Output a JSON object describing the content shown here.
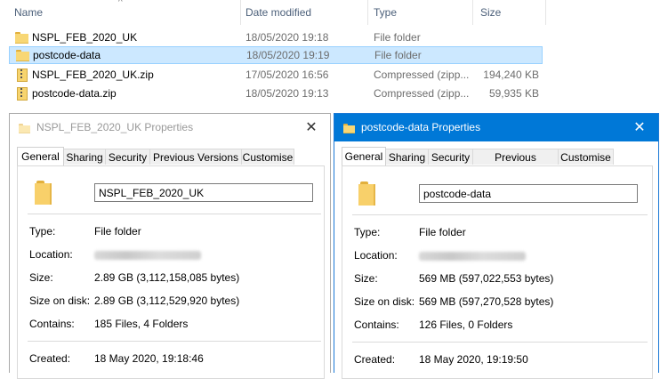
{
  "explorer": {
    "columns": {
      "name": "Name",
      "date": "Date modified",
      "type": "Type",
      "size": "Size"
    },
    "rows": [
      {
        "name": "NSPL_FEB_2020_UK",
        "date": "18/05/2020 19:18",
        "type": "File folder",
        "size": "",
        "icon": "folder-icon",
        "selected": false
      },
      {
        "name": "postcode-data",
        "date": "18/05/2020 19:19",
        "type": "File folder",
        "size": "",
        "icon": "folder-icon",
        "selected": true
      },
      {
        "name": "NSPL_FEB_2020_UK.zip",
        "date": "17/05/2020 16:56",
        "type": "Compressed (zipp...",
        "size": "194,240 KB",
        "icon": "zip-icon",
        "selected": false
      },
      {
        "name": "postcode-data.zip",
        "date": "18/05/2020 19:13",
        "type": "Compressed (zipp...",
        "size": "59,935 KB",
        "icon": "zip-icon",
        "selected": false
      }
    ]
  },
  "dialog1": {
    "title": "NSPL_FEB_2020_UK Properties",
    "close": "✕",
    "tabs": [
      "General",
      "Sharing",
      "Security",
      "Previous Versions",
      "Customise"
    ],
    "name_value": "NSPL_FEB_2020_UK",
    "labels": {
      "type": "Type:",
      "location": "Location:",
      "size": "Size:",
      "size_on_disk": "Size on disk:",
      "contains": "Contains:",
      "created": "Created:"
    },
    "type": "File folder",
    "size": "2.89 GB (3,112,158,085 bytes)",
    "size_on_disk": "2.89 GB (3,112,529,920 bytes)",
    "contains": "185 Files, 4 Folders",
    "created": "18 May 2020, 19:18:46"
  },
  "dialog2": {
    "title": "postcode-data Properties",
    "close": "✕",
    "tabs": [
      "General",
      "Sharing",
      "Security",
      "Previous Versions",
      "Customise"
    ],
    "name_value": "postcode-data",
    "labels": {
      "type": "Type:",
      "location": "Location:",
      "size": "Size:",
      "size_on_disk": "Size on disk:",
      "contains": "Contains:",
      "created": "Created:"
    },
    "type": "File folder",
    "size": "569 MB (597,022,553 bytes)",
    "size_on_disk": "569 MB (597,270,528 bytes)",
    "contains": "126 Files, 0 Folders",
    "created": "18 May 2020, 19:19:50"
  },
  "colors": {
    "accent": "#0078d7",
    "selection": "#cce8ff",
    "folder": "#f8d775"
  }
}
